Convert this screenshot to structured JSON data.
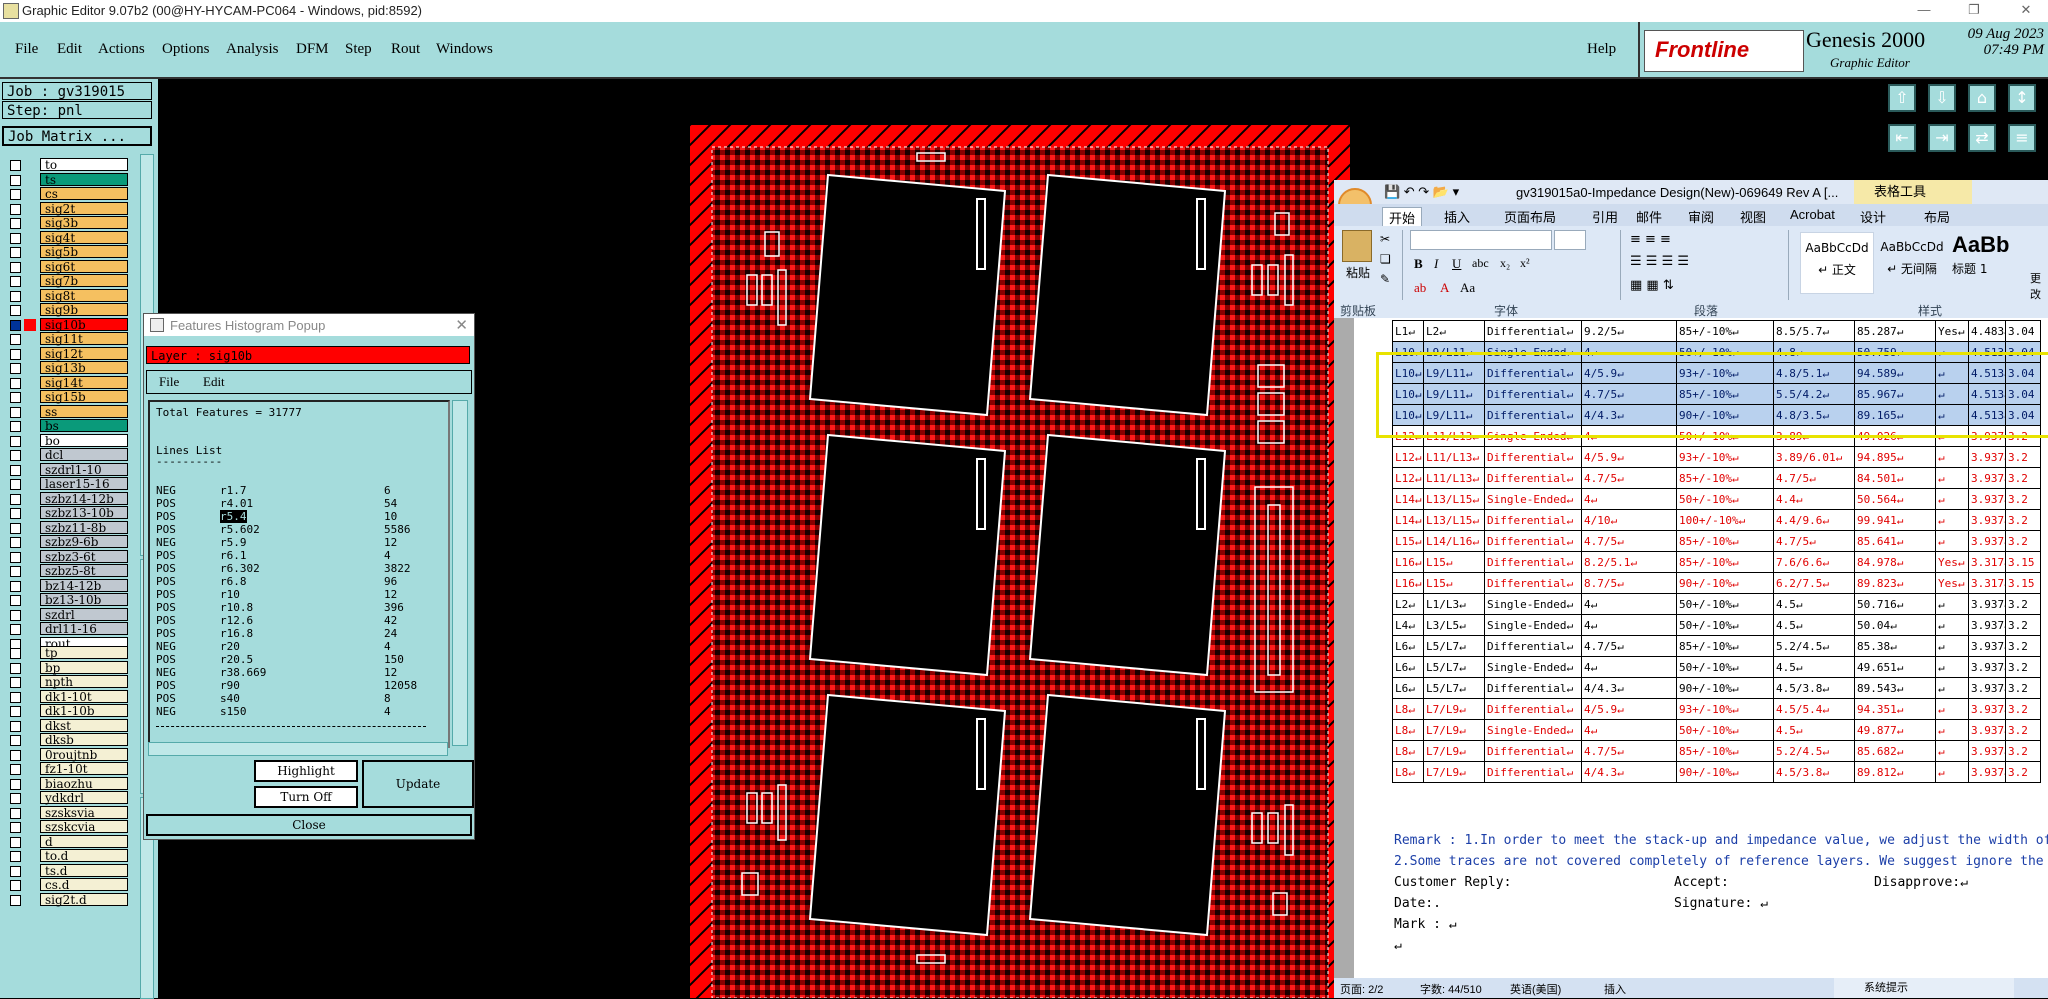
{
  "window": {
    "title": "Graphic Editor 9.07b2 (00@HY-HYCAM-PC064 - Windows, pid:8592)"
  },
  "menu": [
    "File",
    "Edit",
    "Actions",
    "Options",
    "Analysis",
    "DFM",
    "Step",
    "Rout",
    "Windows"
  ],
  "help": "Help",
  "brand": {
    "logo": "Frontline",
    "product": "Genesis 2000",
    "subtitle": "Graphic Editor",
    "date": "09 Aug 2023",
    "time": "07:49 PM"
  },
  "job": {
    "job_label": "Job : gv319015",
    "step_label": "Step: pnl",
    "matrix_button": "Job Matrix ..."
  },
  "layers_group1": [
    "to",
    "ts",
    "cs",
    "sig2t",
    "sig3b",
    "sig4t",
    "sig5b",
    "sig6t",
    "sig7b",
    "sig8t",
    "sig9b",
    "sig10b",
    "sig11t",
    "sig12t",
    "sig13b",
    "sig14t",
    "sig15b",
    "ss",
    "bs",
    "bo"
  ],
  "layers_group2": [
    "dcl",
    "szdrl1-10",
    "laser15-16",
    "szbz14-12b",
    "szbz13-10b",
    "szbz11-8b",
    "szbz9-6b",
    "szbz3-6t",
    "szbz5-8t",
    "bz14-12b",
    "bz13-10b",
    "szdrl",
    "drl11-16",
    "rout"
  ],
  "layers_group3": [
    "tp",
    "bp",
    "npth",
    "dk1-10t",
    "dk1-10b",
    "dkst",
    "dksb",
    "0roujtnb",
    "fz1-10t",
    "biaozhu",
    "ydkdrl",
    "szsksvia",
    "szskcvia",
    "d",
    "to.d",
    "ts.d",
    "cs.d",
    "sig2t.d"
  ],
  "popup": {
    "title": "Features Histogram Popup",
    "layer_label": "Layer :  sig10b",
    "menu": [
      "File",
      "Edit"
    ],
    "total": "Total Features = 31777",
    "section": "Lines List",
    "underline": "----------",
    "rows": [
      [
        "NEG",
        "r1.7",
        "6"
      ],
      [
        "POS",
        "r4.01",
        "54"
      ],
      [
        "POS",
        "r5.4",
        "10"
      ],
      [
        "POS",
        "r5.602",
        "5586"
      ],
      [
        "NEG",
        "r5.9",
        "12"
      ],
      [
        "POS",
        "r6.1",
        "4"
      ],
      [
        "POS",
        "r6.302",
        "3822"
      ],
      [
        "POS",
        "r6.8",
        "96"
      ],
      [
        "POS",
        "r10",
        "12"
      ],
      [
        "POS",
        "r10.8",
        "396"
      ],
      [
        "POS",
        "r12.6",
        "42"
      ],
      [
        "POS",
        "r16.8",
        "24"
      ],
      [
        "NEG",
        "r20",
        "4"
      ],
      [
        "POS",
        "r20.5",
        "150"
      ],
      [
        "NEG",
        "r38.669",
        "12"
      ],
      [
        "POS",
        "r90",
        "12058"
      ],
      [
        "POS",
        "s40",
        "8"
      ],
      [
        "NEG",
        "s150",
        "4"
      ]
    ],
    "highlight_button": "Highlight",
    "turnoff_button": "Turn Off",
    "update_button": "Update",
    "close_button": "Close"
  },
  "word": {
    "title": "gv319015a0-Impedance Design(New)-069649 Rev A [...",
    "context_tab": "表格工具",
    "tabs": [
      "开始",
      "插入",
      "页面布局",
      "引用",
      "邮件",
      "审阅",
      "视图",
      "Acrobat",
      "设计",
      "布局"
    ],
    "groups": [
      "剪贴板",
      "字体",
      "段落",
      "样式"
    ],
    "paste": "粘贴",
    "styles": [
      {
        "sample": "AaBbCcDd",
        "name": "↵ 正文"
      },
      {
        "sample": "AaBbCcDd",
        "name": "↵ 无间隔"
      },
      {
        "sample": "AaBb",
        "name": "标题 1"
      }
    ],
    "more": "更改",
    "table_rows": [
      {
        "c": [
          "L1↵",
          "L2↵",
          "Differential↵",
          "9.2/5↵",
          "85+/-10%↵",
          "8.5/5.7↵",
          "85.287↵",
          "Yes↵",
          "4.483↵",
          "3.04"
        ],
        "k": "blk"
      },
      {
        "c": [
          "L10↵",
          "L9/L11↵",
          "Single-Ended↵",
          "4↵",
          "50+/-10%↵",
          "4.8↵",
          "50.759↵",
          "↵",
          "4.513↵",
          "3.04"
        ],
        "k": "hl"
      },
      {
        "c": [
          "L10↵",
          "L9/L11↵",
          "Differential↵",
          "4/5.9↵",
          "93+/-10%↵",
          "4.8/5.1↵",
          "94.589↵",
          "↵",
          "4.513↵",
          "3.04"
        ],
        "k": "hl"
      },
      {
        "c": [
          "L10↵",
          "L9/L11↵",
          "Differential↵",
          "4.7/5↵",
          "85+/-10%↵",
          "5.5/4.2↵",
          "85.967↵",
          "↵",
          "4.513↵",
          "3.04"
        ],
        "k": "hl"
      },
      {
        "c": [
          "L10↵",
          "L9/L11↵",
          "Differential↵",
          "4/4.3↵",
          "90+/-10%↵",
          "4.8/3.5↵",
          "89.165↵",
          "↵",
          "4.513↵",
          "3.04"
        ],
        "k": "hl"
      },
      {
        "c": [
          "L12↵",
          "L11/L13↵",
          "Single-Ended↵",
          "4↵",
          "50+/-10%↵",
          "3.89↵",
          "49.026↵",
          "↵",
          "3.937↵",
          "3.2"
        ],
        "k": "red"
      },
      {
        "c": [
          "L12↵",
          "L11/L13↵",
          "Differential↵",
          "4/5.9↵",
          "93+/-10%↵",
          "3.89/6.01↵",
          "94.895↵",
          "↵",
          "3.937↵",
          "3.2"
        ],
        "k": "red"
      },
      {
        "c": [
          "L12↵",
          "L11/L13↵",
          "Differential↵",
          "4.7/5↵",
          "85+/-10%↵",
          "4.7/5↵",
          "84.501↵",
          "↵",
          "3.937↵",
          "3.2"
        ],
        "k": "red"
      },
      {
        "c": [
          "L14↵",
          "L13/L15↵",
          "Single-Ended↵",
          "4↵",
          "50+/-10%↵",
          "4.4↵",
          "50.564↵",
          "↵",
          "3.937↵",
          "3.2"
        ],
        "k": "red"
      },
      {
        "c": [
          "L14↵",
          "L13/L15↵",
          "Differential↵",
          "4/10↵",
          "100+/-10%↵",
          "4.4/9.6↵",
          "99.941↵",
          "↵",
          "3.937↵",
          "3.2"
        ],
        "k": "red"
      },
      {
        "c": [
          "L15↵",
          "L14/L16↵",
          "Differential↵",
          "4.7/5↵",
          "85+/-10%↵",
          "4.7/5↵",
          "85.641↵",
          "↵",
          "3.937↵",
          "3.2"
        ],
        "k": "red"
      },
      {
        "c": [
          "L16↵",
          "L15↵",
          "Differential↵",
          "8.2/5.1↵",
          "85+/-10%↵",
          "7.6/6.6↵",
          "84.978↵",
          "Yes↵",
          "3.317↵",
          "3.15"
        ],
        "k": "red"
      },
      {
        "c": [
          "L16↵",
          "L15↵",
          "Differential↵",
          "8.7/5↵",
          "90+/-10%↵",
          "6.2/7.5↵",
          "89.823↵",
          "Yes↵",
          "3.317↵",
          "3.15"
        ],
        "k": "red"
      },
      {
        "c": [
          "L2↵",
          "L1/L3↵",
          "Single-Ended↵",
          "4↵",
          "50+/-10%↵",
          "4.5↵",
          "50.716↵",
          "↵",
          "3.937↵",
          "3.2"
        ],
        "k": "blk"
      },
      {
        "c": [
          "L4↵",
          "L3/L5↵",
          "Single-Ended↵",
          "4↵",
          "50+/-10%↵",
          "4.5↵",
          "50.04↵",
          "↵",
          "3.937↵",
          "3.2"
        ],
        "k": "blk"
      },
      {
        "c": [
          "L6↵",
          "L5/L7↵",
          "Differential↵",
          "4.7/5↵",
          "85+/-10%↵",
          "5.2/4.5↵",
          "85.38↵",
          "↵",
          "3.937↵",
          "3.2"
        ],
        "k": "blk"
      },
      {
        "c": [
          "L6↵",
          "L5/L7↵",
          "Single-Ended↵",
          "4↵",
          "50+/-10%↵",
          "4.5↵",
          "49.651↵",
          "↵",
          "3.937↵",
          "3.2"
        ],
        "k": "blk"
      },
      {
        "c": [
          "L6↵",
          "L5/L7↵",
          "Differential↵",
          "4/4.3↵",
          "90+/-10%↵",
          "4.5/3.8↵",
          "89.543↵",
          "↵",
          "3.937↵",
          "3.2"
        ],
        "k": "blk"
      },
      {
        "c": [
          "L8↵",
          "L7/L9↵",
          "Differential↵",
          "4/5.9↵",
          "93+/-10%↵",
          "4.5/5.4↵",
          "94.351↵",
          "↵",
          "3.937↵",
          "3.2"
        ],
        "k": "red"
      },
      {
        "c": [
          "L8↵",
          "L7/L9↵",
          "Single-Ended↵",
          "4↵",
          "50+/-10%↵",
          "4.5↵",
          "49.877↵",
          "↵",
          "3.937↵",
          "3.2"
        ],
        "k": "red"
      },
      {
        "c": [
          "L8↵",
          "L7/L9↵",
          "Differential↵",
          "4.7/5↵",
          "85+/-10%↵",
          "5.2/4.5↵",
          "85.682↵",
          "↵",
          "3.937↵",
          "3.2"
        ],
        "k": "red"
      },
      {
        "c": [
          "L8↵",
          "L7/L9↵",
          "Differential↵",
          "4/4.3↵",
          "90+/-10%↵",
          "4.5/3.8↵",
          "89.812↵",
          "↵",
          "3.937↵",
          "3.2"
        ],
        "k": "red"
      }
    ],
    "remark1": "Remark : 1.In order to meet the stack-up and impedance value, we adjust the width of",
    "remark2": "2.Some traces are not covered completely of reference layers. We suggest ignore the",
    "customer_reply": "Customer Reply:",
    "accept": "Accept:",
    "disapprove": "Disapprove:↵",
    "date": "Date:.",
    "signature": "Signature: ↵",
    "mark": "Mark : ↵",
    "para": "↵",
    "status_page": "页面: 2/2",
    "status_words": "字数: 44/510",
    "status_lang": "英语(美国)",
    "status_insert": "插入",
    "notify": "系统提示"
  },
  "colors": {
    "panel": "#a5dcdc",
    "board_red": "#ff0000",
    "selected_layer": "#ff0000",
    "board_layer_color": "#00a070"
  }
}
